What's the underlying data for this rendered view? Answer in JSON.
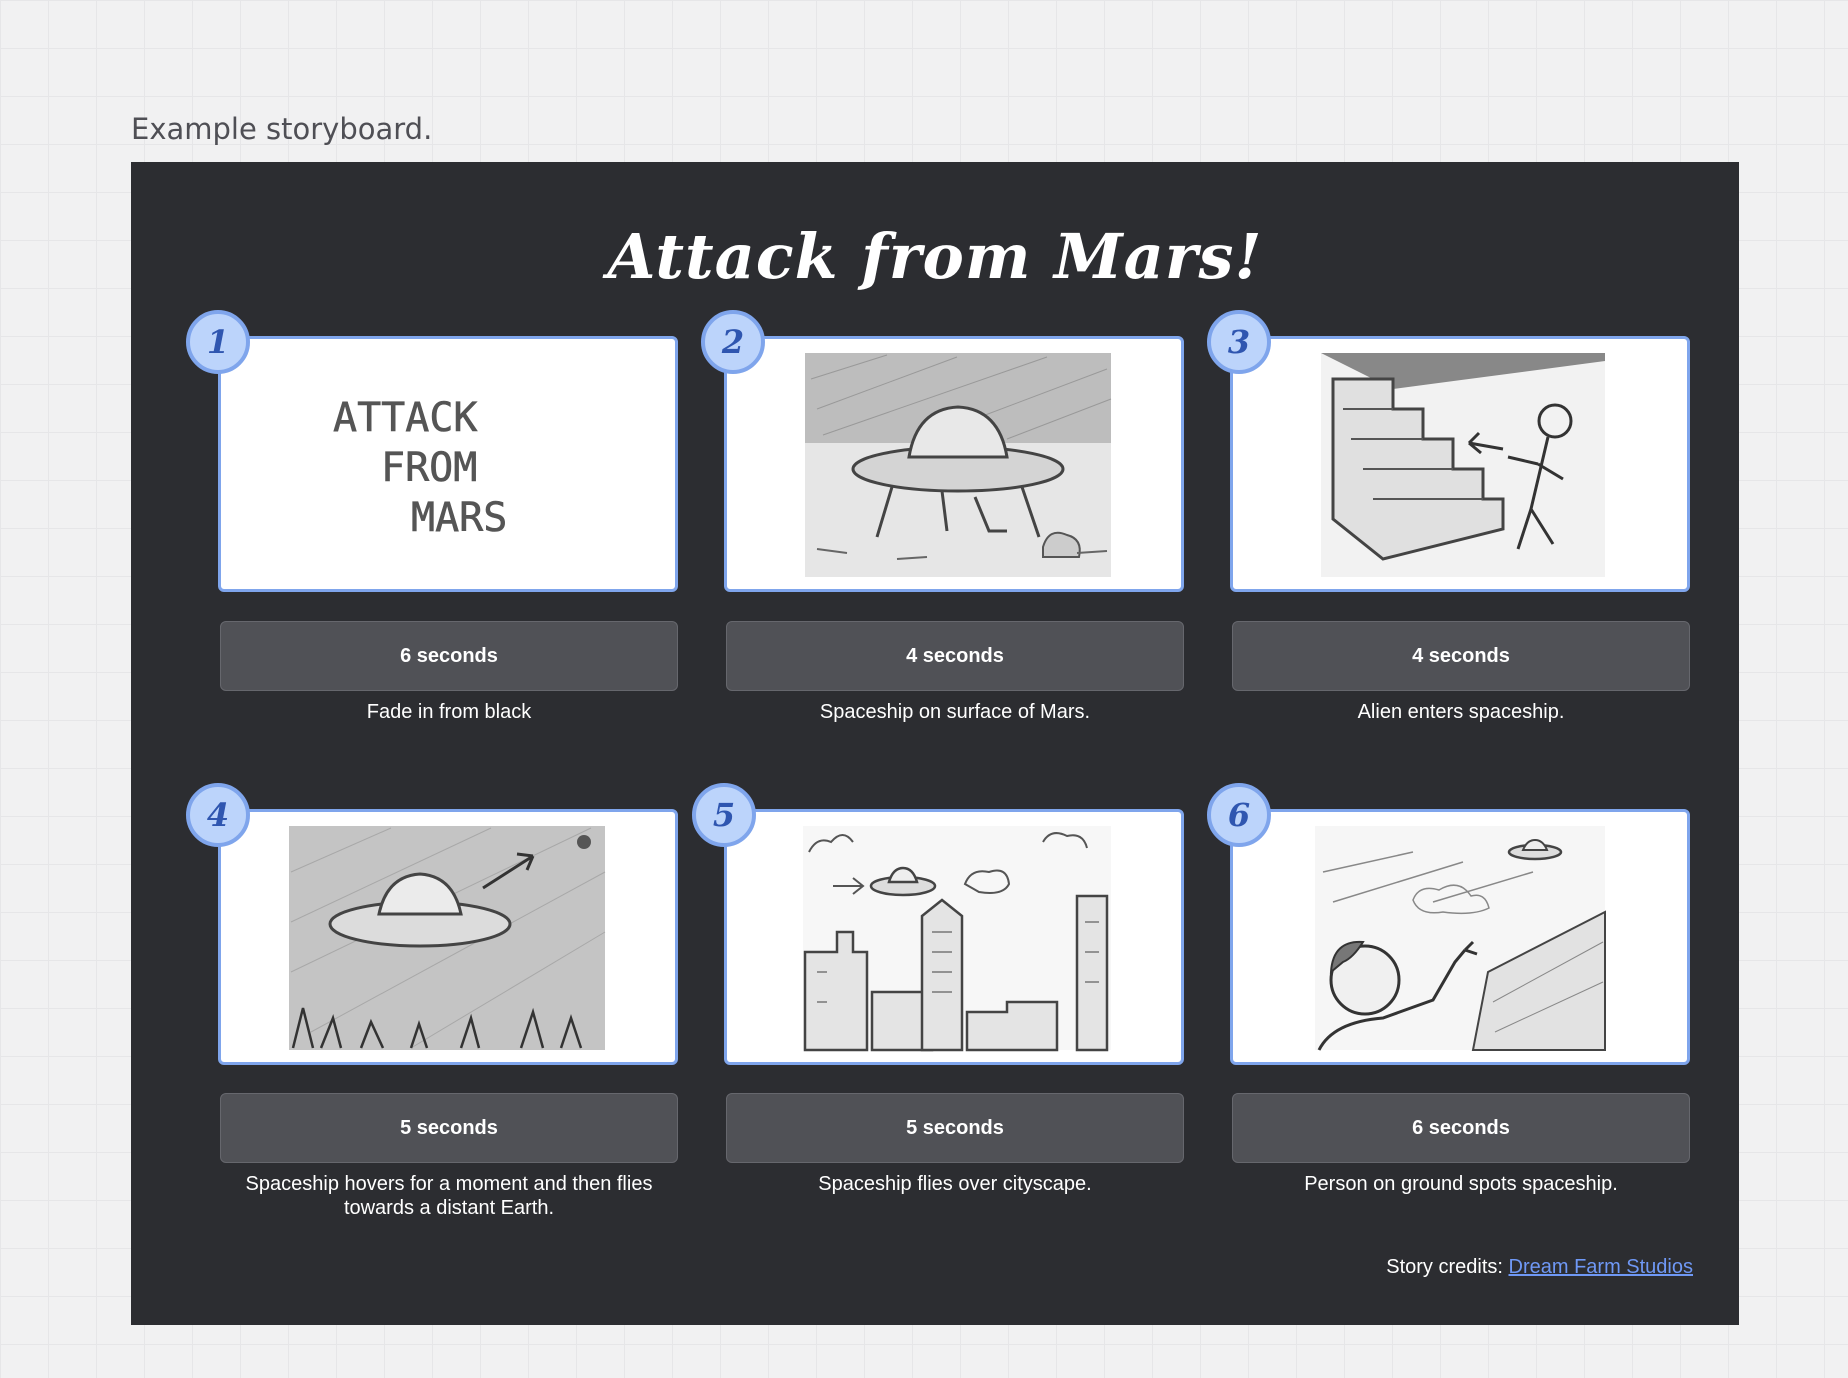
{
  "caption": "Example storyboard.",
  "storyboard": {
    "title": "Attack from Mars!",
    "panels": [
      {
        "number": "1",
        "duration": "6 seconds",
        "description": "Fade in from black",
        "sketch_text": [
          "ATTACK",
          "FROM",
          "MARS"
        ]
      },
      {
        "number": "2",
        "duration": "4 seconds",
        "description": "Spaceship on surface of Mars."
      },
      {
        "number": "3",
        "duration": "4 seconds",
        "description": "Alien enters spaceship."
      },
      {
        "number": "4",
        "duration": "5 seconds",
        "description": "Spaceship hovers for a moment and then flies towards a distant Earth."
      },
      {
        "number": "5",
        "duration": "5 seconds",
        "description": "Spaceship flies over cityscape."
      },
      {
        "number": "6",
        "duration": "6 seconds",
        "description": "Person on ground spots spaceship."
      }
    ],
    "credits": {
      "label": "Story credits:",
      "link_text": "Dream Farm Studios"
    }
  },
  "colors": {
    "board": "#2c2d31",
    "frame_border": "#7fa5ec",
    "badge_fill": "#bcd4fb",
    "badge_text": "#2f56b0",
    "duration_fill": "#505156",
    "link": "#6f98f5"
  }
}
